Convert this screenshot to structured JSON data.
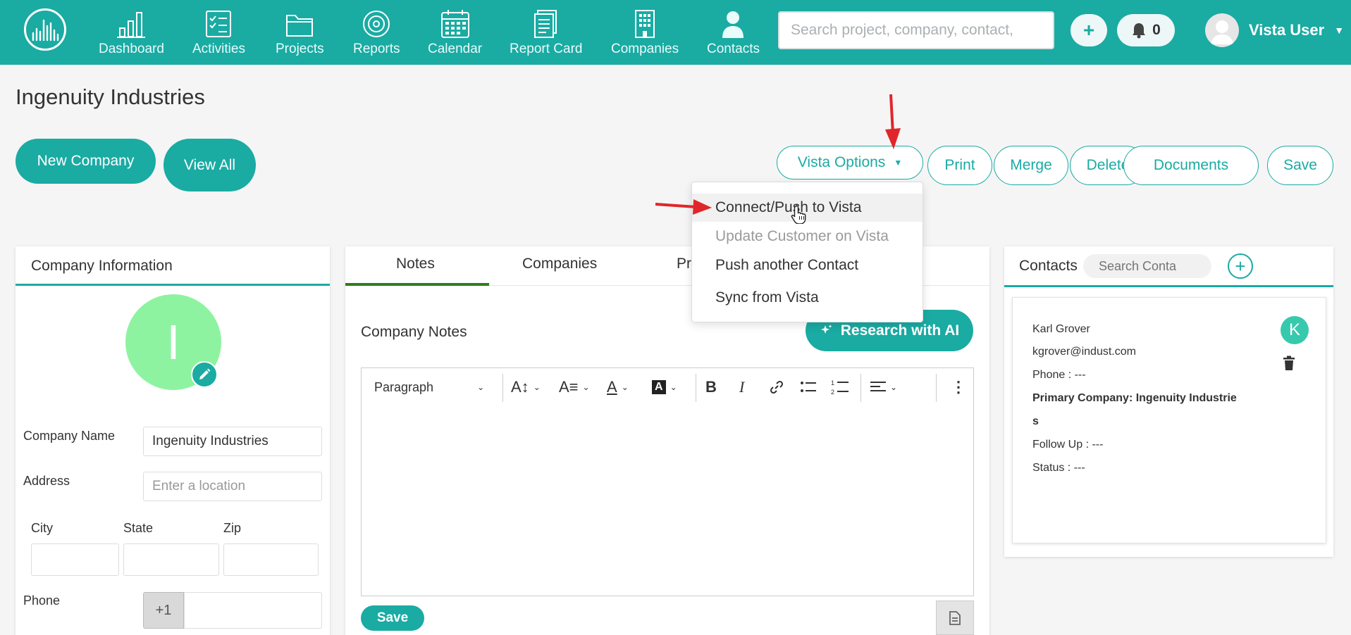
{
  "nav": {
    "items": [
      {
        "label": "Dashboard"
      },
      {
        "label": "Activities"
      },
      {
        "label": "Projects"
      },
      {
        "label": "Reports"
      },
      {
        "label": "Calendar"
      },
      {
        "label": "Report Card"
      },
      {
        "label": "Companies"
      },
      {
        "label": "Contacts"
      }
    ],
    "search_placeholder": "Search project, company, contact,",
    "add_label": "+",
    "notification_count": "0",
    "user_name": "Vista User"
  },
  "page": {
    "title": "Ingenuity Industries",
    "new_company": "New Company",
    "view_all": "View All"
  },
  "actions": {
    "vista_options": "Vista Options",
    "print": "Print",
    "merge": "Merge",
    "delete": "Delete",
    "documents": "Documents",
    "save": "Save"
  },
  "dropdown": {
    "items": [
      {
        "label": "Connect/Push to Vista",
        "state": "hover"
      },
      {
        "label": "Update Customer on Vista",
        "state": "disabled"
      },
      {
        "label": "Push another Contact",
        "state": "normal"
      },
      {
        "label": "Sync from Vista",
        "state": "normal"
      }
    ]
  },
  "company_info": {
    "header": "Company Information",
    "avatar_letter": "I",
    "avatar_color": "#8ef3a1",
    "company_name_label": "Company Name",
    "company_name_value": "Ingenuity Industries",
    "address_label": "Address",
    "address_placeholder": "Enter a location",
    "city_label": "City",
    "state_label": "State",
    "zip_label": "Zip",
    "phone_label": "Phone",
    "phone_prefix": "+1"
  },
  "notes": {
    "tabs": [
      {
        "label": "Notes"
      },
      {
        "label": "Companies"
      },
      {
        "label": "Pr"
      }
    ],
    "section_title": "Company Notes",
    "research_button": "Research with AI",
    "paragraph_select": "Paragraph",
    "save_label": "Save"
  },
  "contacts": {
    "header": "Contacts",
    "search_placeholder": "Search Conta",
    "card": {
      "name": "Karl Grover",
      "email": "kgrover@indust.com",
      "phone": "Phone : ---",
      "primary_company_line1": "Primary Company: Ingenuity Industrie",
      "primary_company_line2": "s",
      "follow_up": "Follow Up : ---",
      "status": "Status : ---",
      "avatar_letter": "K"
    }
  },
  "colors": {
    "brand": "#1aaba3",
    "annotation_arrow": "#e0262a"
  },
  "icons": [
    "logo-icon",
    "dashboard-icon",
    "activities-icon",
    "projects-icon",
    "reports-icon",
    "calendar-icon",
    "report-card-icon",
    "companies-icon",
    "contacts-icon",
    "bell-icon",
    "pencil-icon",
    "trash-icon",
    "sparkle-icon",
    "document-icon",
    "hand-cursor-icon"
  ]
}
